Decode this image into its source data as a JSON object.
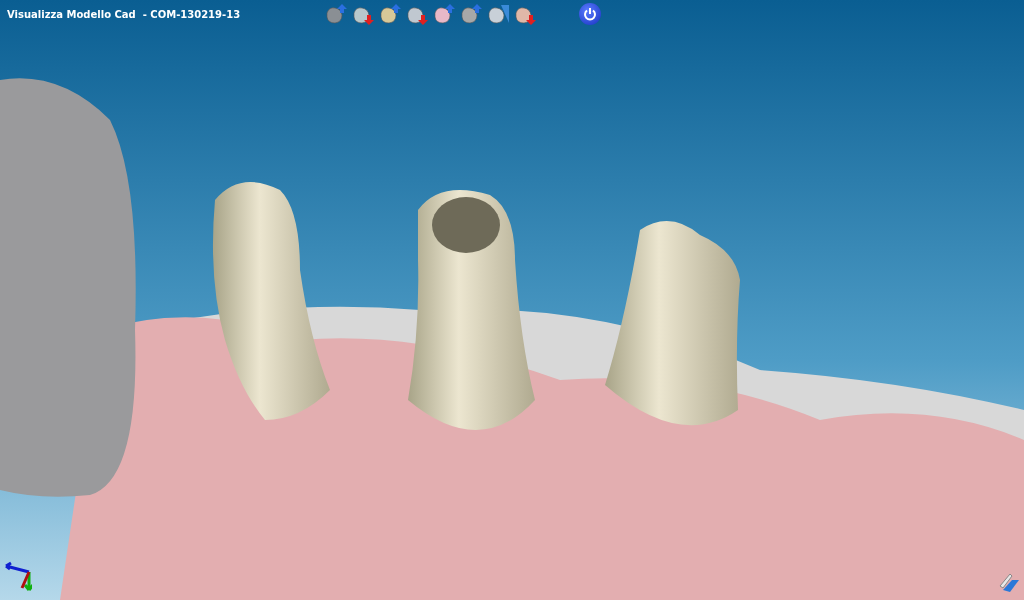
{
  "window": {
    "title": "Visualizza Modello Cad  - COM-130219-13"
  },
  "toolbar": [
    {
      "kind": "up"
    },
    {
      "kind": "down"
    },
    {
      "kind": "up"
    },
    {
      "kind": "down"
    },
    {
      "kind": "up"
    },
    {
      "kind": "up"
    },
    {
      "kind": "diag"
    },
    {
      "kind": "down"
    }
  ]
}
